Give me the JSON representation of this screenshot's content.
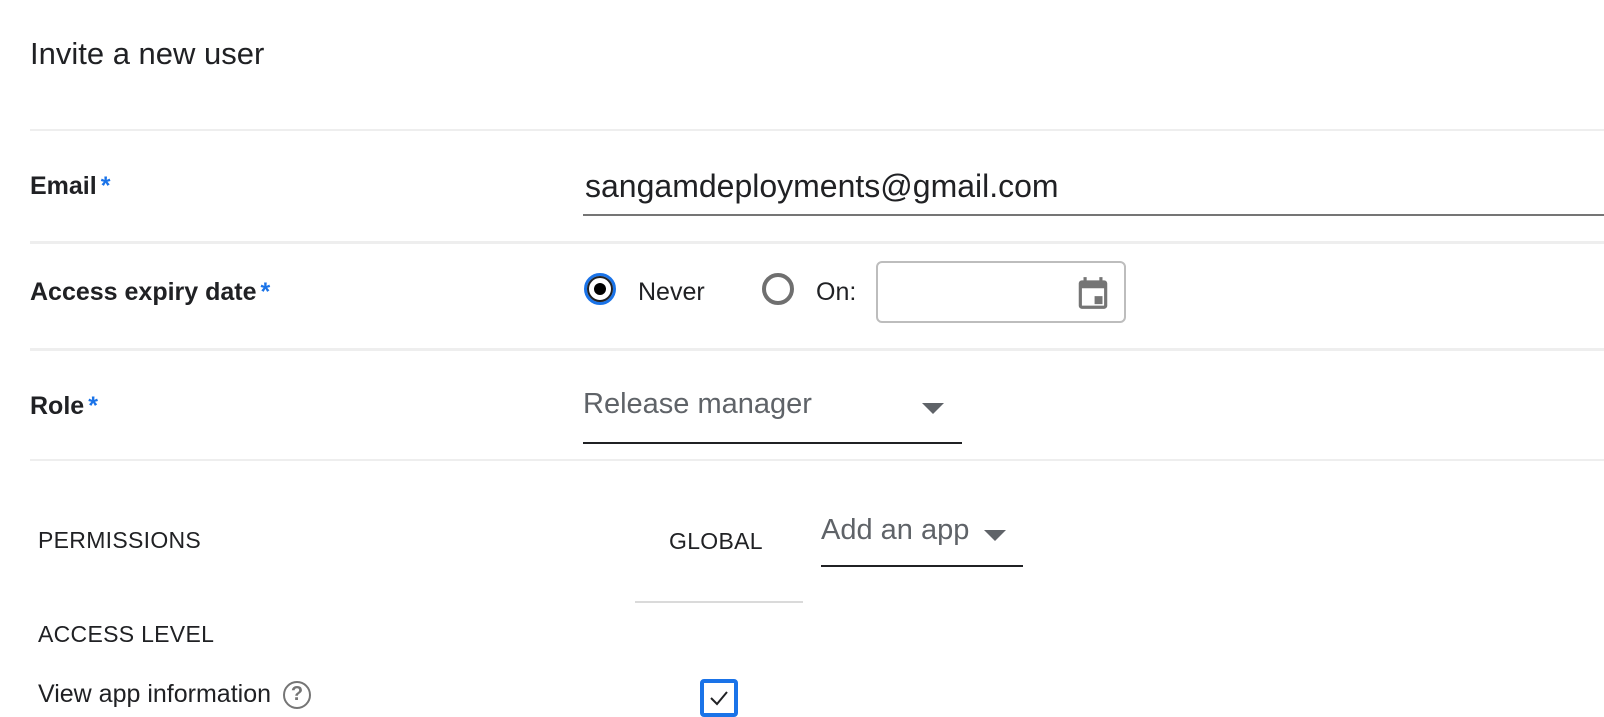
{
  "dialog": {
    "title": "Invite a new user"
  },
  "email": {
    "label": "Email",
    "required_mark": "*",
    "value": "sangamdeployments@gmail.com"
  },
  "access_expiry": {
    "label": "Access expiry date",
    "required_mark": "*",
    "options": [
      {
        "label": "Never",
        "selected": true
      },
      {
        "label": "On:",
        "selected": false
      }
    ],
    "date_value": "",
    "date_icon": "calendar-icon"
  },
  "role": {
    "label": "Role",
    "required_mark": "*",
    "selected": "Release manager",
    "dropdown_icon": "caret-down-icon"
  },
  "permissions": {
    "heading": "PERMISSIONS",
    "scope_global": "GLOBAL",
    "add_app_placeholder": "Add an app",
    "access_level_heading": "ACCESS LEVEL",
    "rows": [
      {
        "label": "View app information",
        "help_glyph": "?",
        "global_checked": true
      }
    ]
  },
  "colors": {
    "accent": "#1a73e8",
    "text": "#202124",
    "muted": "#5f6368",
    "divider": "#eeeeee"
  }
}
